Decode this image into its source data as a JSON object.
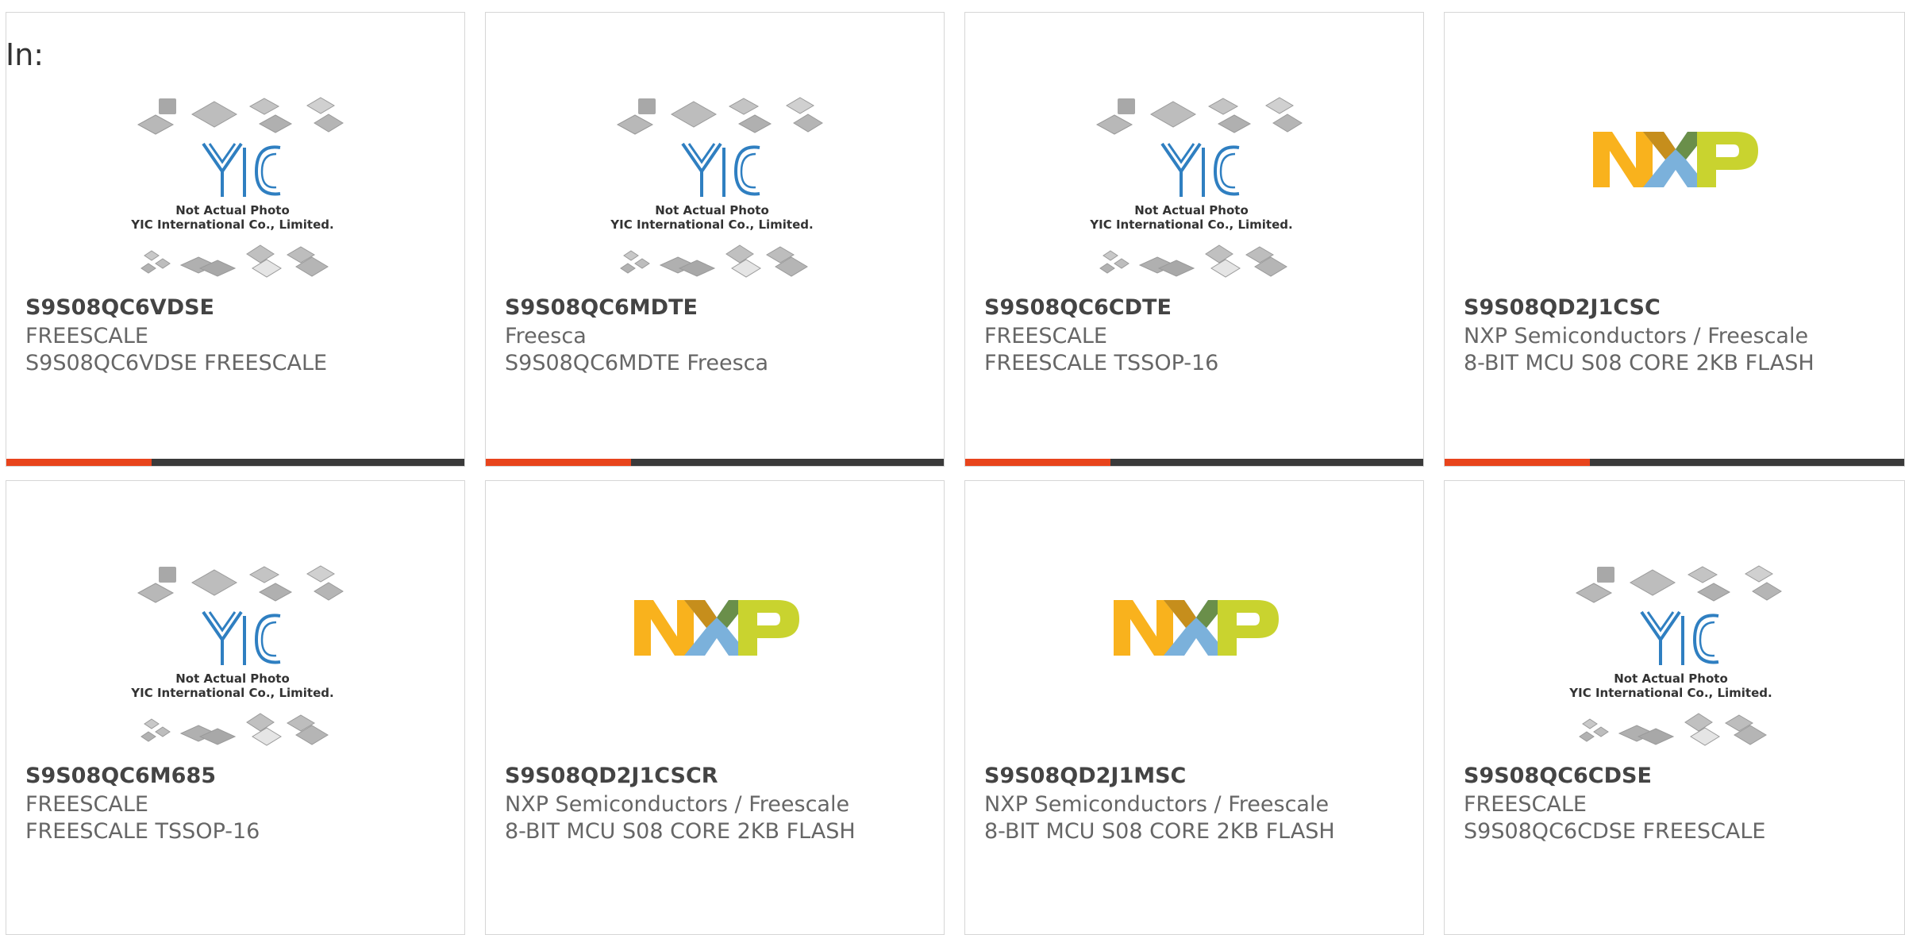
{
  "header": {
    "in_label": "In:"
  },
  "colors": {
    "accent": "#e8441c",
    "bar_dark": "#3a3a3a",
    "yic_blue": "#2f7fc1"
  },
  "placeholder_image": {
    "line1": "Not Actual Photo",
    "line2": "YIC International Co., Limited.",
    "logo": "YIC"
  },
  "cards": [
    {
      "part": "S9S08QC6VDSE",
      "maker": "FREESCALE",
      "desc": "S9S08QC6VDSE FREESCALE",
      "image": "yic-placeholder"
    },
    {
      "part": "S9S08QC6MDTE",
      "maker": "Freesca",
      "desc": "S9S08QC6MDTE Freesca",
      "image": "yic-placeholder"
    },
    {
      "part": "S9S08QC6CDTE",
      "maker": "FREESCALE",
      "desc": "FREESCALE TSSOP-16",
      "image": "yic-placeholder"
    },
    {
      "part": "S9S08QD2J1CSC",
      "maker": "NXP Semiconductors / Freescale",
      "desc": "8-BIT MCU S08 CORE 2KB FLASH",
      "image": "nxp-logo"
    },
    {
      "part": "S9S08QC6M685",
      "maker": "FREESCALE",
      "desc": "FREESCALE TSSOP-16",
      "image": "yic-placeholder"
    },
    {
      "part": "S9S08QD2J1CSCR",
      "maker": "NXP Semiconductors / Freescale",
      "desc": "8-BIT MCU S08 CORE 2KB FLASH",
      "image": "nxp-logo"
    },
    {
      "part": "S9S08QD2J1MSC",
      "maker": "NXP Semiconductors / Freescale",
      "desc": "8-BIT MCU S08 CORE 2KB FLASH",
      "image": "nxp-logo"
    },
    {
      "part": "S9S08QC6CDSE",
      "maker": "FREESCALE",
      "desc": "S9S08QC6CDSE FREESCALE",
      "image": "yic-placeholder"
    }
  ]
}
